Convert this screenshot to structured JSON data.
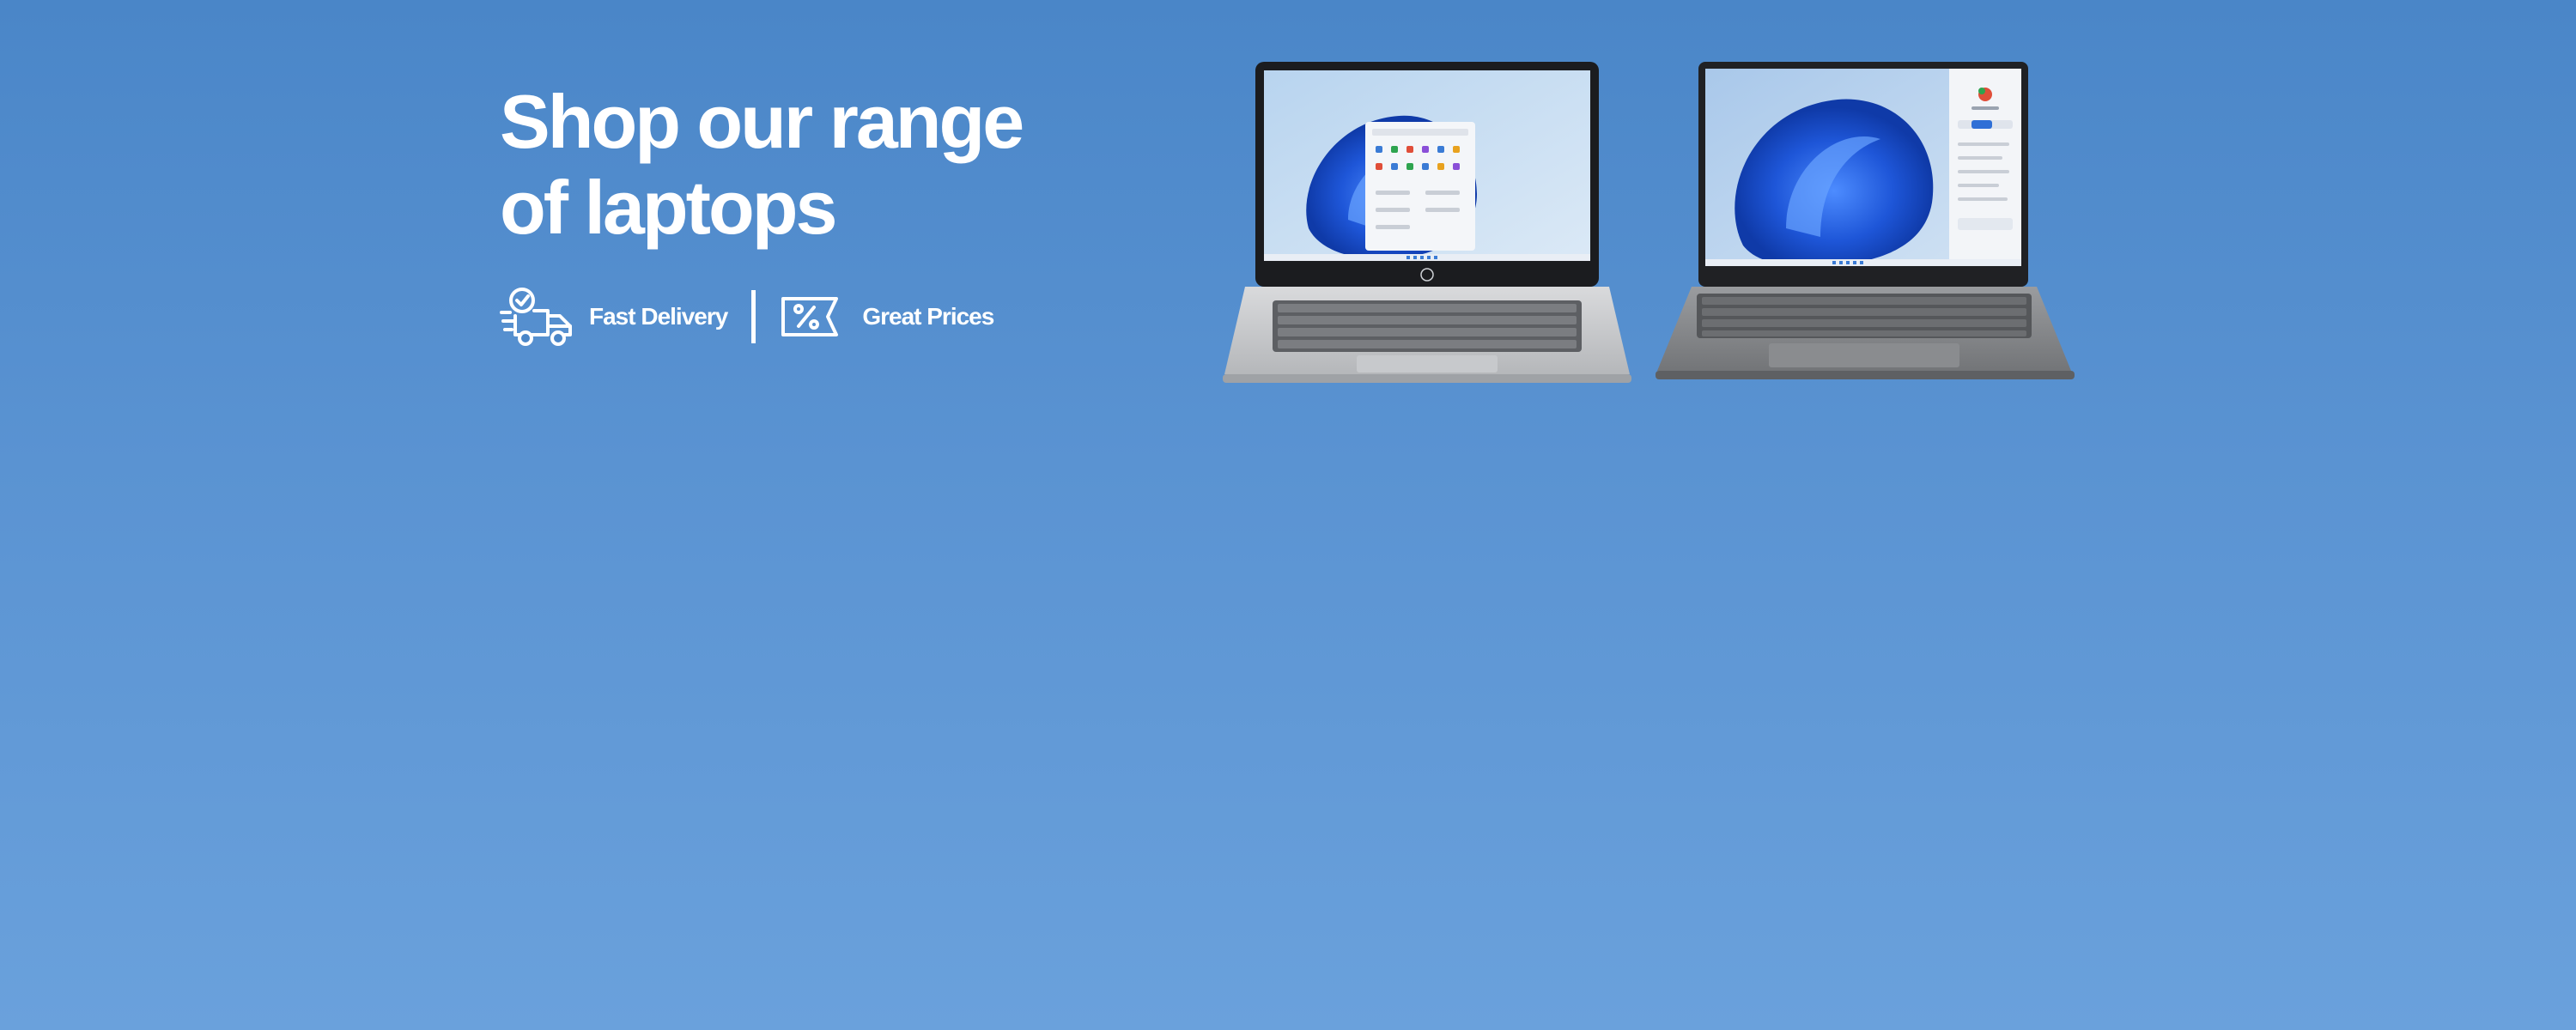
{
  "hero": {
    "headline_line1": "Shop our range",
    "headline_line2": "of laptops",
    "features": [
      {
        "icon": "delivery-truck-icon",
        "label": "Fast Delivery"
      },
      {
        "icon": "price-tag-icon",
        "label": "Great Prices"
      }
    ]
  },
  "products": [
    {
      "name": "laptop-silver",
      "icon": "laptop-image"
    },
    {
      "name": "laptop-grey",
      "icon": "laptop-image"
    }
  ],
  "colors": {
    "background_top": "#4a86c8",
    "background_bottom": "#6aa1dc",
    "text": "#ffffff",
    "screen_blue": "#1e56d8"
  }
}
